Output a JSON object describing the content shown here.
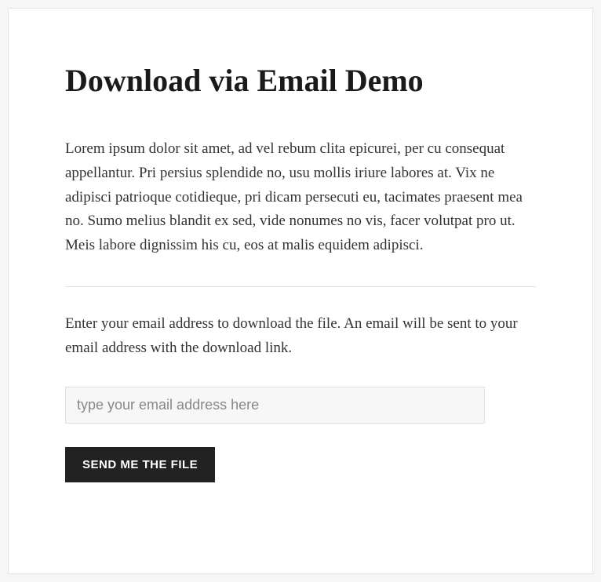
{
  "header": {
    "title": "Download via Email Demo"
  },
  "content": {
    "body_text": "Lorem ipsum dolor sit amet, ad vel rebum clita epicurei, per cu consequat appellantur. Pri persius splendide no, usu mollis iriure labores at. Vix ne adipisci patrioque cotidieque, pri dicam persecuti eu, tacimates praesent mea no. Sumo melius blandit ex sed, vide nonumes no vis, facer volutpat pro ut. Meis labore dignissim his cu, eos at malis equidem adipisci.",
    "instruction_text": "Enter your email address to download the file. An email will be sent to your email address with the download link."
  },
  "form": {
    "email_placeholder": "type your email address here",
    "email_value": "",
    "submit_label": "SEND ME THE FILE"
  }
}
